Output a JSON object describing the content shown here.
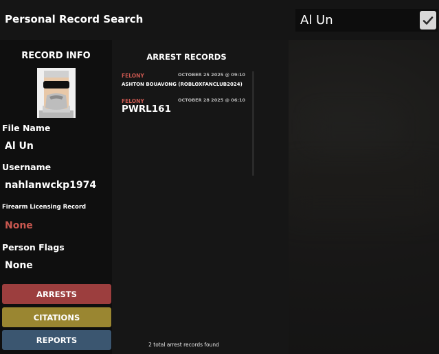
{
  "header": {
    "title": "Personal Record Search",
    "search_value": "Al Un"
  },
  "record_info": {
    "heading": "RECORD INFO",
    "fields": [
      {
        "label": "File Name",
        "value": "Al Un"
      },
      {
        "label": "Username",
        "value": "nahlanwckp1974"
      },
      {
        "label": "Firearm Licensing Record",
        "value": "None",
        "value_color": "#c8574f"
      },
      {
        "label": "Person Flags",
        "value": "None"
      }
    ]
  },
  "buttons": {
    "arrests": "ARRESTS",
    "citations": "CITATIONS",
    "reports": "REPORTS"
  },
  "arrest_records": {
    "heading": "ARREST RECORDS",
    "items": [
      {
        "type": "FELONY",
        "date": "OCTOBER 25 2025 @ 09:10",
        "description": "ASHTON BOUAVONG (ROBLOXFANCLUB2024)"
      },
      {
        "type": "FELONY",
        "date": "OCTOBER 28 2025 @ 06:10",
        "description": "PWRL161"
      }
    ],
    "footer": "2 total arrest records found"
  },
  "colors": {
    "felony": "#c8574f",
    "arrests_button": "#9c3e3e",
    "citations_button": "#9a8631",
    "reports_button": "#3b5670"
  }
}
